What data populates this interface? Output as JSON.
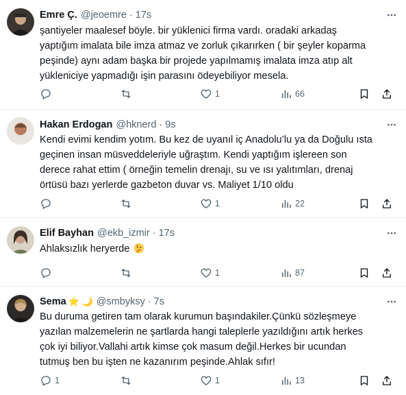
{
  "tweets": [
    {
      "name": "Emre Ç.",
      "badge": "",
      "handle": "@jeoemre",
      "dot": "·",
      "time": "17s",
      "lines": [
        "şantiyeler maalesef böyle.  bir yüklenici firma vardı. oradaki arkadaş",
        "yaptığım imalata bile imza atmaz ve zorluk çıkarırken ( bir şeyler koparma",
        "peşinde)  aynı adam başka bir projede yapılmamış imalata imza atıp alt",
        "yükleniciye yapmadığı işin parasını ödeyebiliyor mesela."
      ],
      "counts": {
        "reply": "",
        "retweet": "",
        "like": "1",
        "views": "66"
      }
    },
    {
      "name": "Hakan Erdogan",
      "badge": "",
      "handle": "@hknerd",
      "dot": "·",
      "time": "9s",
      "lines": [
        "Kendi evimi kendim yotım. Bu kez de uyanıl iç Anadolu’lu ya da Doğulu  ısta",
        "geçinen insan müsveddeleriyle uğraştım. Kendi yaptığım işlereen son",
        "derece rahat ettim ( örneğin temelin drenajı, su ve ısı yalıtımları, drenaj",
        "örtüsü bazı yerlerde gazbeton duvar vs. Maliyet 1/10 oldu"
      ],
      "counts": {
        "reply": "",
        "retweet": "",
        "like": "1",
        "views": "22"
      }
    },
    {
      "name": "Elif Bayhan",
      "badge": "",
      "handle": "@ekb_izmir",
      "dot": "·",
      "time": "17s",
      "lines": [
        "Ahlaksızlık heryerde"
      ],
      "inline_emoji": "thinking-face",
      "counts": {
        "reply": "",
        "retweet": "",
        "like": "1",
        "views": "87"
      }
    },
    {
      "name": "Sema",
      "badge": "⭐ 🌙",
      "handle": "@smbyksy",
      "dot": "·",
      "time": "7s",
      "lines": [
        "Bu duruma getiren tam olarak  kurumun başındakiler.Çünkü sözleşmeye",
        "yazılan malzemelerin ne şartlarda hangi taleplerle yazıldığını artık herkes",
        "çok iyi biliyor.Vallahi artık kimse çok masum değil.Herkes bir ucundan",
        "tutmuş ben bu işten ne kazanırım peşinde.Ahlak sıfır!"
      ],
      "counts": {
        "reply": "1",
        "retweet": "",
        "like": "1",
        "views": "13"
      }
    }
  ],
  "colors": {
    "text": "#0f1419",
    "secondary": "#536471",
    "divider": "#eff3f4"
  },
  "icons": [
    "more-icon",
    "reply-icon",
    "retweet-icon",
    "like-icon",
    "views-icon",
    "bookmark-icon",
    "share-icon",
    "thinking-face-emoji"
  ]
}
